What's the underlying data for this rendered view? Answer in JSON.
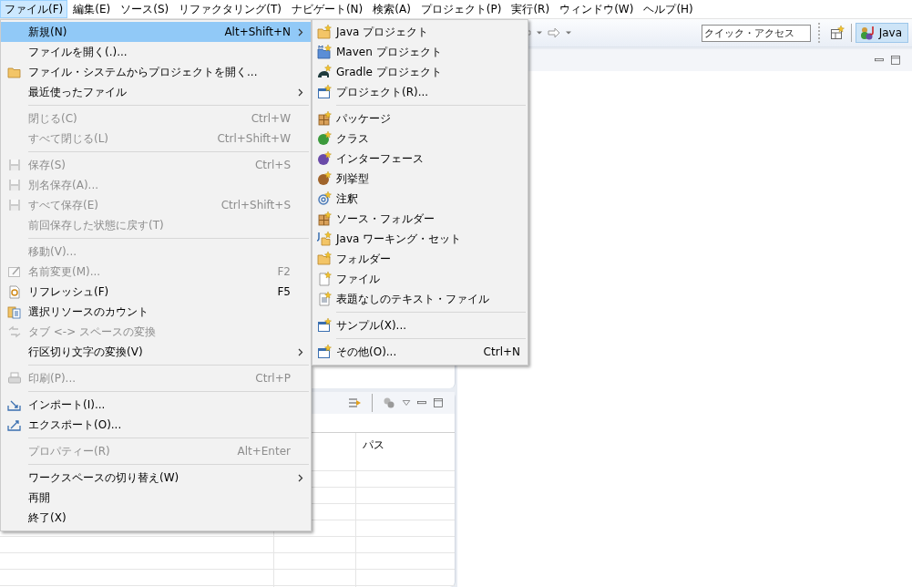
{
  "menu_bar": [
    {
      "label": "ファイル(F)",
      "selected": true
    },
    {
      "label": "編集(E)",
      "selected": false
    },
    {
      "label": "ソース(S)",
      "selected": false
    },
    {
      "label": "リファクタリング(T)",
      "selected": false
    },
    {
      "label": "ナビゲート(N)",
      "selected": false
    },
    {
      "label": "検索(A)",
      "selected": false
    },
    {
      "label": "プロジェクト(P)",
      "selected": false
    },
    {
      "label": "実行(R)",
      "selected": false
    },
    {
      "label": "ウィンドウ(W)",
      "selected": false
    },
    {
      "label": "ヘルプ(H)",
      "selected": false
    }
  ],
  "toolbar": {
    "quick_access": {
      "placeholder": "クイック・アクセス"
    },
    "perspective": {
      "label": "Java",
      "selected": true
    }
  },
  "bottom_panel": {
    "table": {
      "columns": [
        "パス"
      ]
    }
  },
  "file_menu": [
    {
      "kind": "item",
      "label": "新規(N)",
      "shortcut": "Alt+Shift+N",
      "submenu": true,
      "disabled": false,
      "selected": true
    },
    {
      "kind": "item",
      "label": "ファイルを開く(.)...",
      "submenu": false,
      "disabled": false,
      "selected": false
    },
    {
      "kind": "item",
      "label": "ファイル・システムからプロジェクトを開く...",
      "submenu": false,
      "disabled": false,
      "selected": false
    },
    {
      "kind": "item",
      "label": "最近使ったファイル",
      "submenu": true,
      "disabled": false,
      "selected": false
    },
    {
      "kind": "separator"
    },
    {
      "kind": "item",
      "label": "閉じる(C)",
      "shortcut": "Ctrl+W",
      "submenu": false,
      "disabled": true,
      "selected": false
    },
    {
      "kind": "item",
      "label": "すべて閉じる(L)",
      "shortcut": "Ctrl+Shift+W",
      "submenu": false,
      "disabled": true,
      "selected": false
    },
    {
      "kind": "separator"
    },
    {
      "kind": "item",
      "label": "保存(S)",
      "shortcut": "Ctrl+S",
      "submenu": false,
      "disabled": true,
      "selected": false
    },
    {
      "kind": "item",
      "label": "別名保存(A)...",
      "submenu": false,
      "disabled": true,
      "selected": false
    },
    {
      "kind": "item",
      "label": "すべて保存(E)",
      "shortcut": "Ctrl+Shift+S",
      "submenu": false,
      "disabled": true,
      "selected": false
    },
    {
      "kind": "item",
      "label": "前回保存した状態に戻す(T)",
      "submenu": false,
      "disabled": true,
      "selected": false
    },
    {
      "kind": "separator"
    },
    {
      "kind": "item",
      "label": "移動(V)...",
      "submenu": false,
      "disabled": true,
      "selected": false
    },
    {
      "kind": "item",
      "label": "名前変更(M)...",
      "shortcut": "F2",
      "submenu": false,
      "disabled": true,
      "selected": false
    },
    {
      "kind": "item",
      "label": "リフレッシュ(F)",
      "shortcut": "F5",
      "submenu": false,
      "disabled": false,
      "selected": false
    },
    {
      "kind": "item",
      "label": "選択リソースのカウント",
      "submenu": false,
      "disabled": false,
      "selected": false
    },
    {
      "kind": "item",
      "label": "タブ <-> スペースの変換",
      "submenu": false,
      "disabled": true,
      "selected": false
    },
    {
      "kind": "item",
      "label": "行区切り文字の変換(V)",
      "submenu": true,
      "disabled": false,
      "selected": false
    },
    {
      "kind": "separator"
    },
    {
      "kind": "item",
      "label": "印刷(P)...",
      "shortcut": "Ctrl+P",
      "submenu": false,
      "disabled": true,
      "selected": false
    },
    {
      "kind": "separator"
    },
    {
      "kind": "item",
      "label": "インポート(I)...",
      "submenu": false,
      "disabled": false,
      "selected": false
    },
    {
      "kind": "item",
      "label": "エクスポート(O)...",
      "submenu": false,
      "disabled": false,
      "selected": false
    },
    {
      "kind": "separator"
    },
    {
      "kind": "item",
      "label": "プロパティー(R)",
      "shortcut": "Alt+Enter",
      "submenu": false,
      "disabled": true,
      "selected": false
    },
    {
      "kind": "separator"
    },
    {
      "kind": "item",
      "label": "ワークスペースの切り替え(W)",
      "submenu": true,
      "disabled": false,
      "selected": false
    },
    {
      "kind": "item",
      "label": "再開",
      "submenu": false,
      "disabled": false,
      "selected": false
    },
    {
      "kind": "item",
      "label": "終了(X)",
      "submenu": false,
      "disabled": false,
      "selected": false
    }
  ],
  "new_submenu": [
    {
      "kind": "item",
      "label": "Java プロジェクト"
    },
    {
      "kind": "item",
      "label": "Maven プロジェクト"
    },
    {
      "kind": "item",
      "label": "Gradle プロジェクト"
    },
    {
      "kind": "item",
      "label": "プロジェクト(R)..."
    },
    {
      "kind": "separator"
    },
    {
      "kind": "item",
      "label": "パッケージ"
    },
    {
      "kind": "item",
      "label": "クラス"
    },
    {
      "kind": "item",
      "label": "インターフェース"
    },
    {
      "kind": "item",
      "label": "列挙型"
    },
    {
      "kind": "item",
      "label": "注釈"
    },
    {
      "kind": "item",
      "label": "ソース・フォルダー"
    },
    {
      "kind": "item",
      "label": "Java ワーキング・セット"
    },
    {
      "kind": "item",
      "label": "フォルダー"
    },
    {
      "kind": "item",
      "label": "ファイル"
    },
    {
      "kind": "item",
      "label": "表題なしのテキスト・ファイル"
    },
    {
      "kind": "separator"
    },
    {
      "kind": "item",
      "label": "サンプル(X)..."
    },
    {
      "kind": "separator"
    },
    {
      "kind": "item",
      "label": "その他(O)...",
      "shortcut": "Ctrl+N"
    }
  ]
}
